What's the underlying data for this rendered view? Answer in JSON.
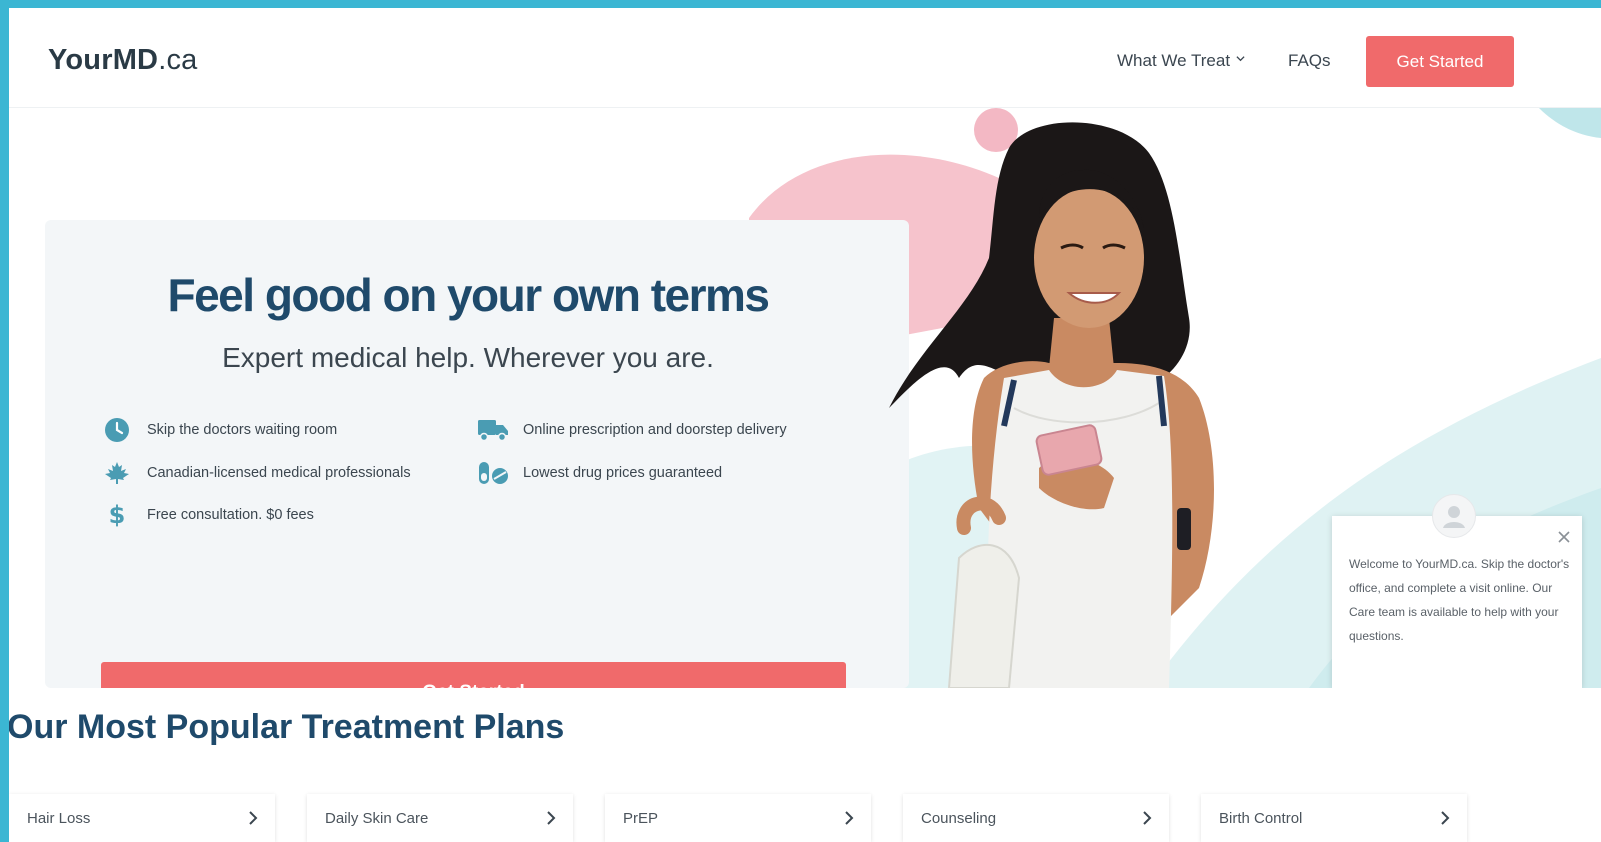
{
  "header": {
    "logo_bold": "YourMD",
    "logo_suffix": ".ca",
    "nav": {
      "treat_label": "What We Treat",
      "faqs_label": "FAQs"
    },
    "cta_label": "Get Started"
  },
  "hero": {
    "headline": "Feel good on your own terms",
    "subline": "Expert medical help. Wherever you are.",
    "features": [
      {
        "label": "Skip the doctors waiting room",
        "icon": "clock-icon"
      },
      {
        "label": "Online prescription and doorstep delivery",
        "icon": "truck-icon"
      },
      {
        "label": "Canadian-licensed medical professionals",
        "icon": "maple-leaf-icon"
      },
      {
        "label": "Lowest drug prices guaranteed",
        "icon": "pills-icon"
      },
      {
        "label": "Free consultation. $0 fees",
        "icon": "dollar-icon"
      }
    ],
    "cta_label": "Get Started"
  },
  "chat": {
    "message": "Welcome to YourMD.ca. Skip the doctor's office, and complete a visit online. Our Care team is available to help with your questions."
  },
  "treatments": {
    "title": "Our Most Popular Treatment Plans",
    "plans": [
      "Hair Loss",
      "Daily Skin Care",
      "PrEP",
      "Counseling",
      "Birth Control"
    ]
  },
  "colors": {
    "accent": "#f06a6b",
    "heading": "#1f4a6b",
    "feature_icon": "#4a9cb3",
    "frame": "#3bb6d3"
  }
}
